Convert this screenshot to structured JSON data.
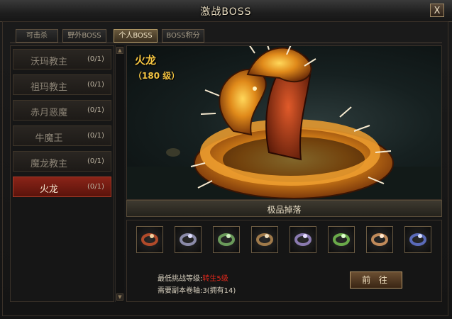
{
  "window": {
    "title": "激战BOSS",
    "close_label": "X"
  },
  "tabs": [
    {
      "label": "可击杀",
      "active": false
    },
    {
      "label": "野外BOSS",
      "active": false
    },
    {
      "label": "个人BOSS",
      "active": true
    },
    {
      "label": "BOSS积分",
      "active": false
    }
  ],
  "bosses": [
    {
      "name": "沃玛教主",
      "count": "(0/1)",
      "selected": false
    },
    {
      "name": "祖玛教主",
      "count": "(0/1)",
      "selected": false
    },
    {
      "name": "赤月恶魔",
      "count": "(0/1)",
      "selected": false
    },
    {
      "name": "牛魔王",
      "count": "(0/1)",
      "selected": false
    },
    {
      "name": "魔龙教主",
      "count": "(0/1)",
      "selected": false
    },
    {
      "name": "火龙",
      "count": "(0/1)",
      "selected": true
    }
  ],
  "detail": {
    "name": "火龙",
    "level": "（180 级）",
    "drops_title": "极品掉落",
    "drop_items": [
      "ring-icon",
      "ring-icon",
      "ring-icon",
      "ring-icon",
      "ring-icon",
      "ring-icon",
      "ring-icon",
      "ring-icon"
    ],
    "drop_colors": [
      "#b04a2a",
      "#8a8aa8",
      "#6a9a5a",
      "#a07a4a",
      "#8a7ab0",
      "#6aaa4a",
      "#c08a5a",
      "#5a6ab8"
    ],
    "min_level_label": "最低挑战等级:",
    "min_level_value": "转生5级",
    "scroll_label": "需要副本卷轴:",
    "scroll_value": "3(拥有14)",
    "go_button": "前 往"
  },
  "colors": {
    "accent_gold": "#f4c542",
    "selected_red": "#8a2418",
    "warning_red": "#e0281c"
  }
}
